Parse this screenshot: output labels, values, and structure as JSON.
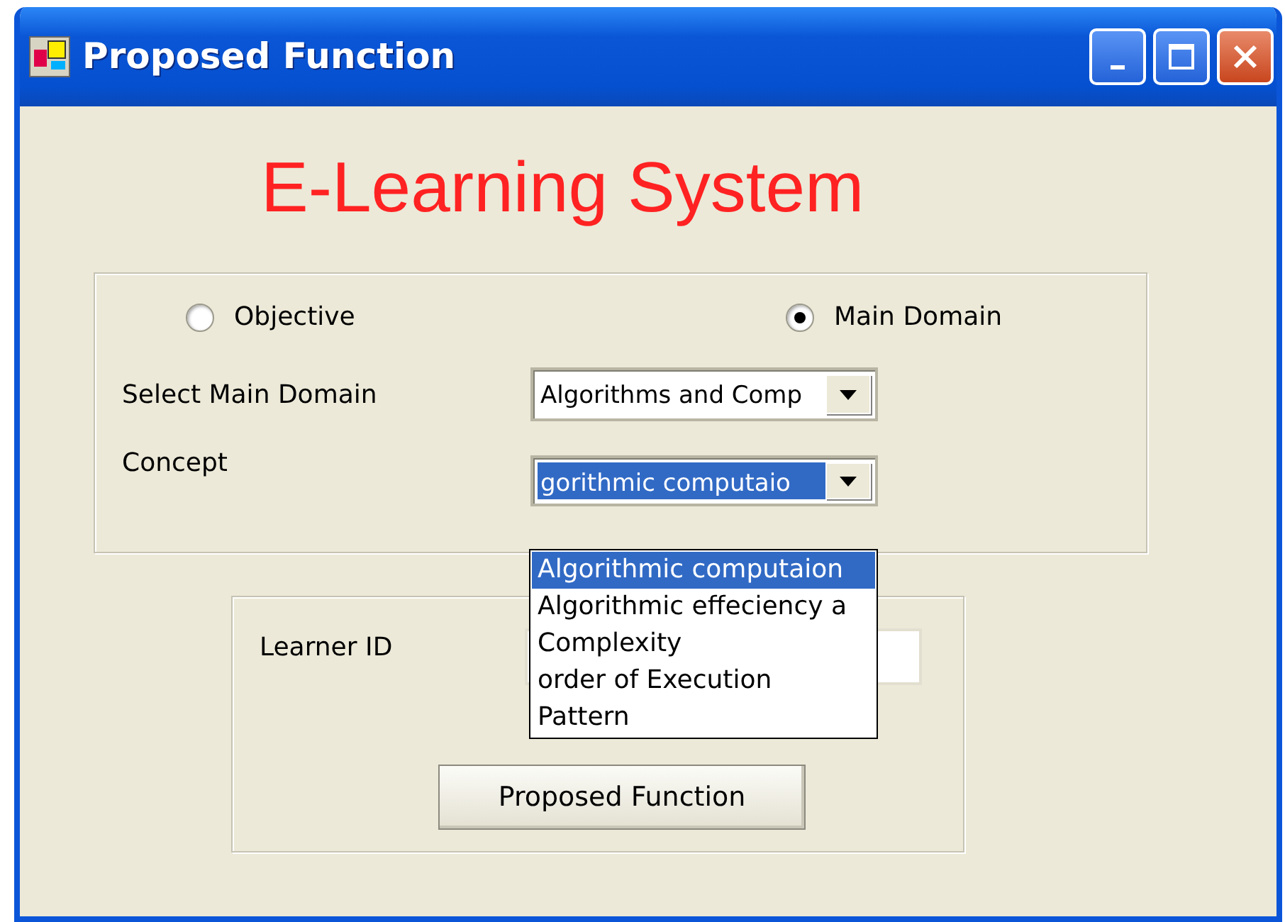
{
  "window": {
    "title": "Proposed Function"
  },
  "heading": "E-Learning System",
  "mode_options": [
    {
      "label": "Objective",
      "selected": false
    },
    {
      "label": "Main Domain",
      "selected": true
    }
  ],
  "main_domain": {
    "label": "Select Main Domain",
    "value": "Algorithms and Comp"
  },
  "concept": {
    "label": "Concept",
    "value": "gorithmic computaio",
    "text_selected": true,
    "expanded": true,
    "options": [
      {
        "label": "Algorithmic computaion",
        "selected": true
      },
      {
        "label": "Algorithmic effeciency a",
        "selected": false
      },
      {
        "label": "Complexity",
        "selected": false
      },
      {
        "label": "order of Execution",
        "selected": false
      },
      {
        "label": "Pattern",
        "selected": false
      }
    ]
  },
  "learner_id": {
    "label": "Learner ID"
  },
  "buttons": [
    "Proposed Function"
  ]
}
